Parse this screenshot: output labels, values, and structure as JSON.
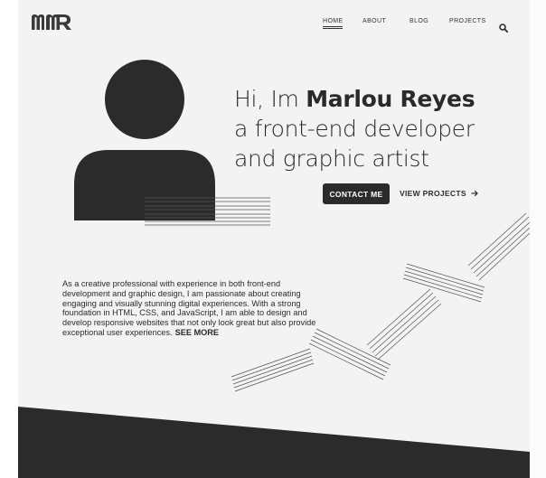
{
  "logo": {
    "text": "MR"
  },
  "nav": {
    "home": "HOME",
    "about": "ABOUT",
    "blog": "BLOG",
    "projects": "PROJECTS"
  },
  "hero": {
    "greeting": "Hi, Im ",
    "name": "Marlou Reyes",
    "line2": "a front-end developer",
    "line3": "and graphic artist"
  },
  "actions": {
    "contact": "CONTACT ME",
    "view_projects": "VIEW PROJECTS"
  },
  "intro": {
    "text": "As a creative professional with experience in both front-end development and graphic design, I am passionate about creating engaging and visually stunning digital experiences. With a strong foundation in HTML, CSS, and JavaScript, I am able to design and develop responsive websites that not only look great but also provide exceptional user experiences.",
    "see_more": "SEE MORE"
  },
  "colors": {
    "dark": "#2b2b2b",
    "background": "#f3f3f3"
  }
}
